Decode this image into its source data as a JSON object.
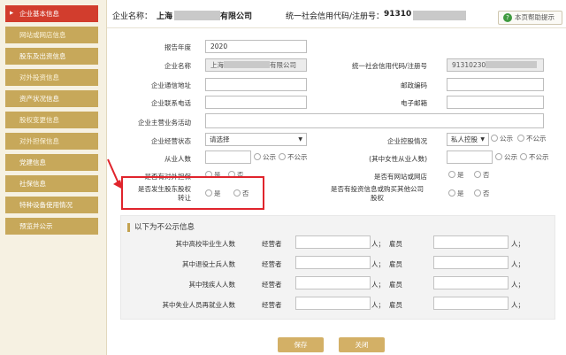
{
  "sidebar": {
    "items": [
      {
        "label": "企业基本信息"
      },
      {
        "label": "网站或网店信息"
      },
      {
        "label": "股东及出资信息"
      },
      {
        "label": "对外投资信息"
      },
      {
        "label": "资产状况信息"
      },
      {
        "label": "股权变更信息"
      },
      {
        "label": "对外担保信息"
      },
      {
        "label": "党建信息"
      },
      {
        "label": "社保信息"
      },
      {
        "label": "特种设备使用情况"
      },
      {
        "label": "预览并公示"
      }
    ]
  },
  "header": {
    "company_label": "企业名称：",
    "company_prefix": "上海",
    "company_suffix": "有限公司",
    "credit_label": "统一社会信用代码/注册号：",
    "credit_value": "91310",
    "help_label": "本页帮助提示",
    "help_icon": "question-icon"
  },
  "form": {
    "report_year_label": "报告年度",
    "report_year_value": "2020",
    "company_name_label": "企业名称",
    "company_name_prefix": "上海",
    "company_name_suffix": "有限公司",
    "credit_code_label": "统一社会信用代码/注册号",
    "credit_code_value": "91310230",
    "address_label": "企业通信地址",
    "postcode_label": "邮政编码",
    "phone_label": "企业联系电话",
    "email_label": "电子邮箱",
    "main_business_label": "企业主营业务活动",
    "status_label": "企业经营状态",
    "status_value": "请选择",
    "holding_label": "企业控股情况",
    "holding_value": "私人控股",
    "employees_label": "从业人数",
    "female_label": "(其中女性从业人数)",
    "guarantee_label": "是否有对外担保",
    "website_label": "是否有网站或网店",
    "equity_transfer_label_line1": "是否发生股东股权",
    "equity_transfer_label_line2": "转让",
    "invest_label_line1": "是否有投资信息或购买其他公司",
    "invest_label_line2": "股权",
    "opt_public": "公示",
    "opt_private": "不公示",
    "opt_yes": "是",
    "opt_no": "否"
  },
  "private_section": {
    "title": "以下为不公示信息",
    "operator_label": "经营者",
    "employee_label": "雇员",
    "unit_person": "人；",
    "rows": [
      {
        "label": "其中高校毕业生人数"
      },
      {
        "label": "其中退役士兵人数"
      },
      {
        "label": "其中残疾人人数"
      },
      {
        "label": "其中失业人员再就业人数"
      }
    ]
  },
  "buttons": {
    "save": "保存",
    "close": "关闭"
  },
  "colors": {
    "sidebar_active": "#d23d2d",
    "sidebar_item": "#c7a85a",
    "button": "#d3b066",
    "highlight": "#e0242c"
  }
}
